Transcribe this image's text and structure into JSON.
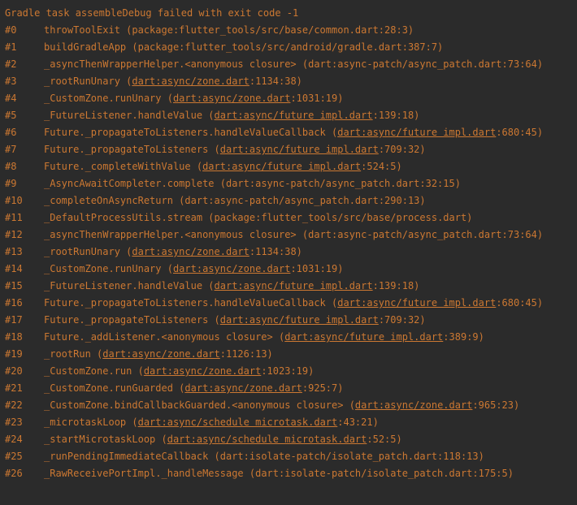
{
  "header": "Gradle task assembleDebug failed with exit code -1",
  "frames": [
    {
      "num": "#0",
      "method": "throwToolExit",
      "prefix": " (package:flutter_tools/src/base/common.dart:28:3)",
      "link": null,
      "suffix": null
    },
    {
      "num": "#1",
      "method": "buildGradleApp",
      "prefix": " (package:flutter_tools/src/android/gradle.dart:387:7)",
      "link": null,
      "suffix": null
    },
    {
      "num": "#2",
      "method": "_asyncThenWrapperHelper.<anonymous closure>",
      "prefix": " (dart:async-patch/async_patch.dart:73:64)",
      "link": null,
      "suffix": null
    },
    {
      "num": "#3",
      "method": "_rootRunUnary",
      "prefix": " (",
      "link": "dart:async/zone.dart",
      "suffix": ":1134:38)"
    },
    {
      "num": "#4",
      "method": "_CustomZone.runUnary",
      "prefix": " (",
      "link": "dart:async/zone.dart",
      "suffix": ":1031:19)"
    },
    {
      "num": "#5",
      "method": "_FutureListener.handleValue",
      "prefix": " (",
      "link": "dart:async/future impl.dart",
      "suffix": ":139:18)"
    },
    {
      "num": "#6",
      "method": "Future._propagateToListeners.handleValueCallback",
      "prefix": " (",
      "link": "dart:async/future impl.dart",
      "suffix": ":680:45)"
    },
    {
      "num": "#7",
      "method": "Future._propagateToListeners",
      "prefix": " (",
      "link": "dart:async/future impl.dart",
      "suffix": ":709:32)"
    },
    {
      "num": "#8",
      "method": "Future._completeWithValue",
      "prefix": " (",
      "link": "dart:async/future impl.dart",
      "suffix": ":524:5)"
    },
    {
      "num": "#9",
      "method": "_AsyncAwaitCompleter.complete",
      "prefix": " (dart:async-patch/async_patch.dart:32:15)",
      "link": null,
      "suffix": null
    },
    {
      "num": "#10",
      "method": "_completeOnAsyncReturn",
      "prefix": " (dart:async-patch/async_patch.dart:290:13)",
      "link": null,
      "suffix": null
    },
    {
      "num": "#11",
      "method": "_DefaultProcessUtils.stream",
      "prefix": " (package:flutter_tools/src/base/process.dart)",
      "link": null,
      "suffix": null
    },
    {
      "num": "#12",
      "method": "_asyncThenWrapperHelper.<anonymous closure>",
      "prefix": " (dart:async-patch/async_patch.dart:73:64)",
      "link": null,
      "suffix": null
    },
    {
      "num": "#13",
      "method": "_rootRunUnary",
      "prefix": " (",
      "link": "dart:async/zone.dart",
      "suffix": ":1134:38)"
    },
    {
      "num": "#14",
      "method": "_CustomZone.runUnary",
      "prefix": " (",
      "link": "dart:async/zone.dart",
      "suffix": ":1031:19)"
    },
    {
      "num": "#15",
      "method": "_FutureListener.handleValue",
      "prefix": " (",
      "link": "dart:async/future impl.dart",
      "suffix": ":139:18)"
    },
    {
      "num": "#16",
      "method": "Future._propagateToListeners.handleValueCallback",
      "prefix": " (",
      "link": "dart:async/future impl.dart",
      "suffix": ":680:45)"
    },
    {
      "num": "#17",
      "method": "Future._propagateToListeners",
      "prefix": " (",
      "link": "dart:async/future impl.dart",
      "suffix": ":709:32)"
    },
    {
      "num": "#18",
      "method": "Future._addListener.<anonymous closure>",
      "prefix": " (",
      "link": "dart:async/future impl.dart",
      "suffix": ":389:9)"
    },
    {
      "num": "#19",
      "method": "_rootRun",
      "prefix": " (",
      "link": "dart:async/zone.dart",
      "suffix": ":1126:13)"
    },
    {
      "num": "#20",
      "method": "_CustomZone.run",
      "prefix": " (",
      "link": "dart:async/zone.dart",
      "suffix": ":1023:19)"
    },
    {
      "num": "#21",
      "method": "_CustomZone.runGuarded",
      "prefix": " (",
      "link": "dart:async/zone.dart",
      "suffix": ":925:7)"
    },
    {
      "num": "#22",
      "method": "_CustomZone.bindCallbackGuarded.<anonymous closure>",
      "prefix": " (",
      "link": "dart:async/zone.dart",
      "suffix": ":965:23)"
    },
    {
      "num": "#23",
      "method": "_microtaskLoop",
      "prefix": " (",
      "link": "dart:async/schedule microtask.dart",
      "suffix": ":43:21)"
    },
    {
      "num": "#24",
      "method": "_startMicrotaskLoop",
      "prefix": " (",
      "link": "dart:async/schedule microtask.dart",
      "suffix": ":52:5)"
    },
    {
      "num": "#25",
      "method": "_runPendingImmediateCallback",
      "prefix": " (dart:isolate-patch/isolate_patch.dart:118:13)",
      "link": null,
      "suffix": null
    },
    {
      "num": "#26",
      "method": "_RawReceivePortImpl._handleMessage",
      "prefix": " (dart:isolate-patch/isolate_patch.dart:175:5)",
      "link": null,
      "suffix": null
    }
  ]
}
